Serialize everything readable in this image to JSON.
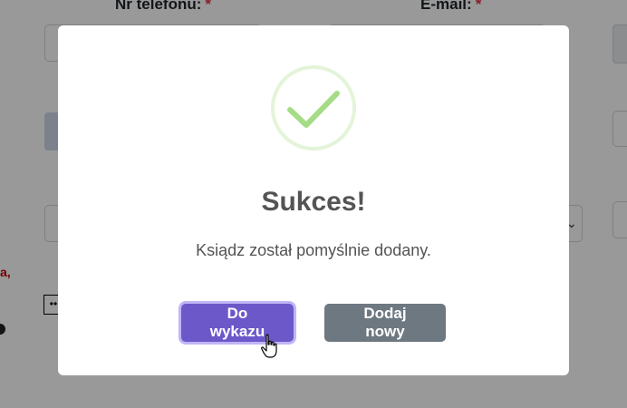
{
  "background": {
    "phone_label": "Nr telefonu:",
    "email_label": "E-mail:",
    "required_marker": "*",
    "red_text": "a,",
    "dots": "••"
  },
  "modal": {
    "icon": "checkmark-icon",
    "title": "Sukces!",
    "message": "Ksiądz został pomyślnie dodany.",
    "primary_button": "Do wykazu",
    "secondary_button": "Dodaj nowy"
  },
  "colors": {
    "primary": "#6c58c9",
    "secondary": "#6e7881",
    "success": "#a5dc86"
  }
}
